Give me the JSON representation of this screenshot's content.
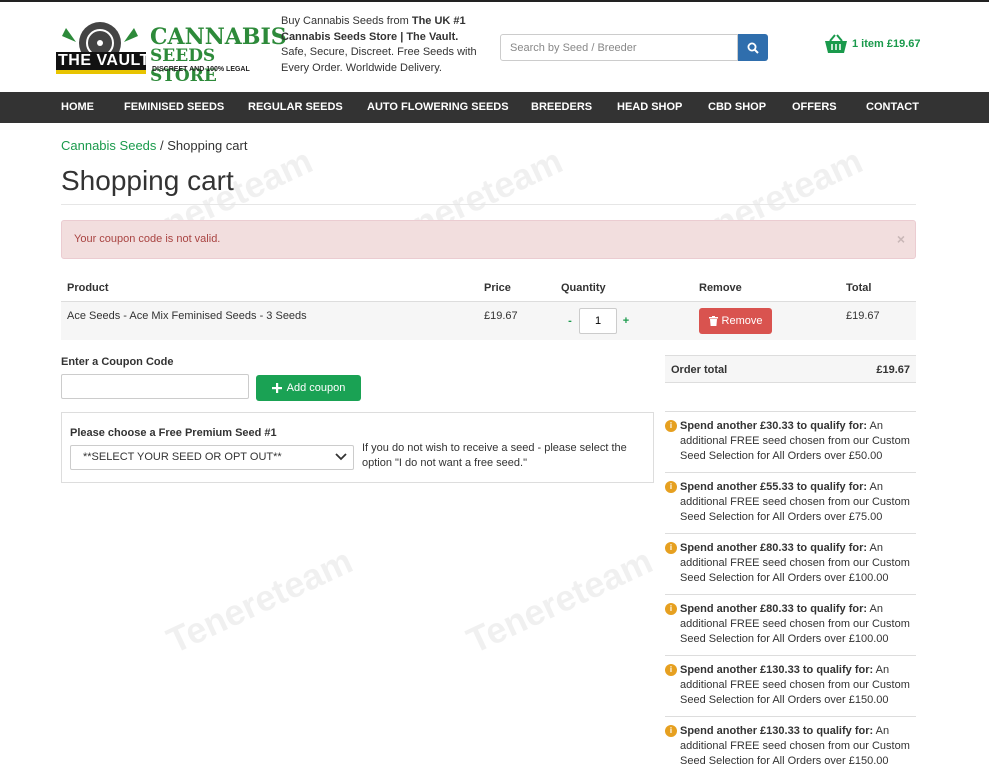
{
  "header": {
    "logo_text_1": "THE VAULT",
    "logo_text_2": "CANNABIS",
    "logo_text_3": "SEEDS STORE",
    "logo_text_4": "DISCREET AND 100% LEGAL",
    "tagline_prefix": "Buy Cannabis Seeds from ",
    "tagline_bold_1": "The UK #1 Cannabis Seeds Store | The Vault.",
    "tagline_suffix": " Safe, Secure, Discreet. Free Seeds with Every Order. Worldwide Delivery.",
    "search_placeholder": "Search by Seed / Breeder",
    "cart_text": "1 item £19.67"
  },
  "nav": [
    "HOME",
    "FEMINISED SEEDS",
    "REGULAR SEEDS",
    "AUTO FLOWERING SEEDS",
    "BREEDERS",
    "HEAD SHOP",
    "CBD SHOP",
    "OFFERS",
    "CONTACT"
  ],
  "breadcrumb": {
    "home": "Cannabis Seeds",
    "sep": " / ",
    "current": "Shopping cart"
  },
  "page_title": "Shopping cart",
  "alert": {
    "message": "Your coupon code is not valid.",
    "close": "×"
  },
  "cart_table": {
    "headers": {
      "product": "Product",
      "price": "Price",
      "quantity": "Quantity",
      "remove": "Remove",
      "total": "Total"
    },
    "rows": [
      {
        "product": "Ace Seeds - Ace Mix Feminised Seeds - 3 Seeds",
        "price": "£19.67",
        "quantity": "1",
        "remove_label": "Remove",
        "total": "£19.67"
      }
    ],
    "minus": "-",
    "plus": "+"
  },
  "coupon": {
    "label": "Enter a Coupon Code",
    "value": "",
    "button_label": "Add coupon"
  },
  "free_seed": {
    "label": "Please choose a Free Premium Seed #1",
    "selected": "**SELECT YOUR SEED OR OPT OUT**",
    "note": "If you do not wish to receive a seed - please select the option \"I do not want a free seed.\""
  },
  "order_total": {
    "label": "Order total",
    "value": "£19.67"
  },
  "offers": [
    {
      "bold": "Spend another £30.33 to qualify for:",
      "text": " An additional FREE seed chosen from our Custom Seed Selection for All Orders over £50.00"
    },
    {
      "bold": "Spend another £55.33 to qualify for:",
      "text": " An additional FREE seed chosen from our Custom Seed Selection for All Orders over £75.00"
    },
    {
      "bold": "Spend another £80.33 to qualify for:",
      "text": " An additional FREE seed chosen from our Custom Seed Selection for All Orders over £100.00"
    },
    {
      "bold": "Spend another £80.33 to qualify for:",
      "text": " An additional FREE seed chosen from our Custom Seed Selection for All Orders over £100.00"
    },
    {
      "bold": "Spend another £130.33 to qualify for:",
      "text": " An additional FREE seed chosen from our Custom Seed Selection for All Orders over £150.00"
    },
    {
      "bold": "Spend another £130.33 to qualify for:",
      "text": " An additional FREE seed chosen from our Custom Seed Selection for All Orders over £150.00"
    }
  ],
  "watermark": "Tenereteam",
  "colors": {
    "brand_green": "#1a9a4c",
    "nav_bg": "#333333",
    "danger": "#d9534f",
    "search_btn": "#2f6ead"
  },
  "icons": {
    "search": "search-icon",
    "cart": "basket-icon",
    "trash": "trash-icon",
    "plus": "plus-icon",
    "info": "info-icon",
    "chevron": "chevron-down-icon"
  }
}
